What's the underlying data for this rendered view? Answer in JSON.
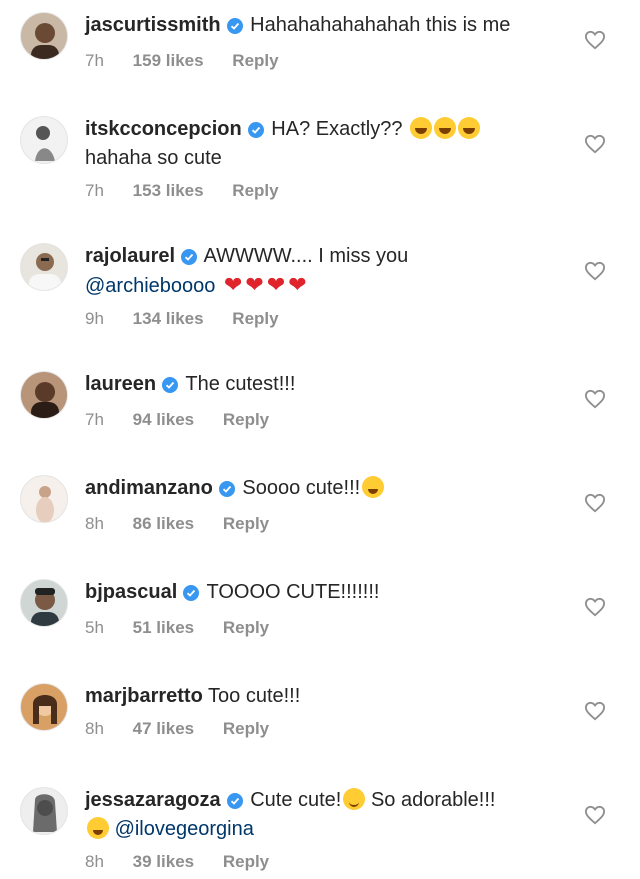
{
  "comments": [
    {
      "username": "jascurtissmith",
      "verified": true,
      "text": "Hahahahahahahah this is me",
      "time": "7h",
      "likes": "159 likes",
      "reply": "Reply"
    },
    {
      "username": "itskcconcepcion",
      "verified": true,
      "text": "HA? Exactly??",
      "text2": "hahaha so cute",
      "emojis": [
        "face-with-tears-of-joy",
        "face-with-tears-of-joy",
        "face-with-tears-of-joy"
      ],
      "time": "7h",
      "likes": "153 likes",
      "reply": "Reply"
    },
    {
      "username": "rajolaurel",
      "verified": true,
      "text": "AWWWW.... I miss you",
      "mention": "@archieboooo",
      "emojis": [
        "red-heart",
        "red-heart",
        "red-heart",
        "red-heart"
      ],
      "time": "9h",
      "likes": "134 likes",
      "reply": "Reply"
    },
    {
      "username": "laureen",
      "verified": true,
      "text": "The cutest!!!",
      "time": "7h",
      "likes": "94 likes",
      "reply": "Reply"
    },
    {
      "username": "andimanzano",
      "verified": true,
      "text": "Soooo cute!!!",
      "emojis": [
        "smiling-face-with-heart-eyes"
      ],
      "time": "8h",
      "likes": "86 likes",
      "reply": "Reply"
    },
    {
      "username": "bjpascual",
      "verified": true,
      "text": "TOOOO CUTE!!!!!!!",
      "time": "5h",
      "likes": "51 likes",
      "reply": "Reply"
    },
    {
      "username": "marjbarretto",
      "verified": false,
      "text": "Too cute!!!",
      "time": "8h",
      "likes": "47 likes",
      "reply": "Reply"
    },
    {
      "username": "jessazaragoza",
      "verified": true,
      "text": "Cute cute!",
      "text_after": "So adorable!!!",
      "mention": "@ilovegeorgina",
      "emojis": [
        "grinning-face",
        "smiling-face-with-heart-eyes"
      ],
      "time": "8h",
      "likes": "39 likes",
      "reply": "Reply"
    }
  ],
  "colors": {
    "text": "#262626",
    "meta": "#8e8e8e",
    "verified": "#3897f0",
    "mention": "#00376b",
    "heart_emoji": "#e0242b"
  },
  "icons": {
    "verified": "verified-badge-icon",
    "like": "heart-outline-icon"
  }
}
